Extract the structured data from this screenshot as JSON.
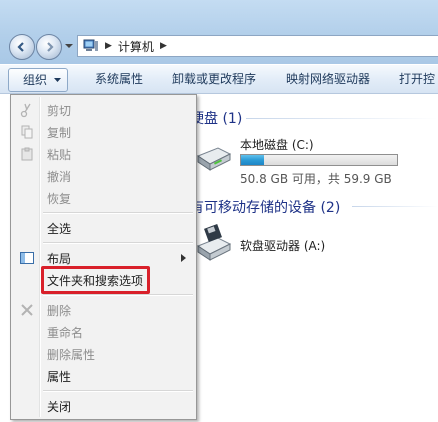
{
  "address_bar": {
    "path": [
      "计算机"
    ]
  },
  "toolbar": {
    "organize_label": "组织",
    "system_properties_label": "系统属性",
    "uninstall_label": "卸载或更改程序",
    "map_drive_label": "映射网络驱动器",
    "open_control_panel_label": "打开控"
  },
  "content": {
    "hard_disks_group": "硬盘 (1)",
    "removable_group": "有可移动存储的设备 (2)",
    "local_disk": {
      "name": "本地磁盘 (C:)",
      "capacity_text": "50.8 GB 可用，共 59.9 GB",
      "used_fraction": 0.15
    },
    "floppy": {
      "name": "软盘驱动器 (A:)"
    }
  },
  "menu": {
    "cut": "剪切",
    "copy": "复制",
    "paste": "粘贴",
    "undo": "撤消",
    "redo": "恢复",
    "select_all": "全选",
    "layout": "布局",
    "folder_options": "文件夹和搜索选项",
    "delete": "删除",
    "rename": "重命名",
    "remove_properties": "删除属性",
    "properties": "属性",
    "close": "关闭"
  },
  "colors": {
    "highlight_border": "#d9202a",
    "capacity_fill": "#2b9bd6",
    "group_title": "#1e3287"
  }
}
